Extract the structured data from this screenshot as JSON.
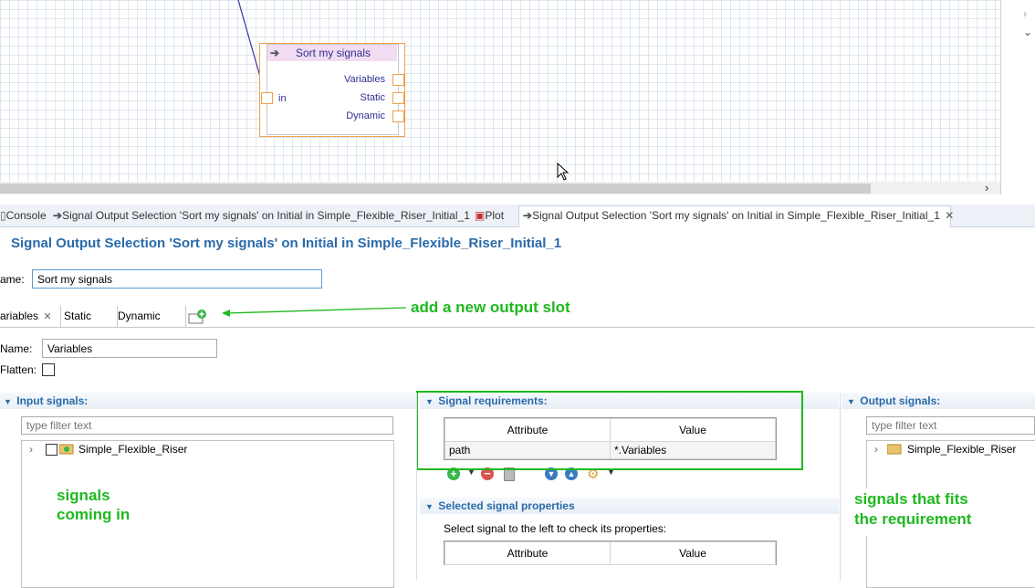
{
  "canvas": {
    "node": {
      "title": "Sort my signals",
      "input_port": "in",
      "output_ports": [
        "Variables",
        "Static",
        "Dynamic"
      ]
    }
  },
  "tabs": [
    {
      "label": "Console",
      "icon": "console-icon"
    },
    {
      "label": "Signal Output Selection 'Sort my signals' on Initial in Simple_Flexible_Riser_Initial_1",
      "icon": "arrow-icon"
    },
    {
      "label": "Plot",
      "icon": "plot-icon"
    },
    {
      "label": "Signal Output Selection 'Sort my signals' on Initial in Simple_Flexible_Riser_Initial_1",
      "icon": "arrow-icon",
      "active": true
    }
  ],
  "editor": {
    "title": "Signal Output Selection 'Sort my signals' on Initial in Simple_Flexible_Riser_Initial_1",
    "name_label": "ame:",
    "name_value": "Sort my signals"
  },
  "slot_tabs": [
    "ariables",
    "Static",
    "Dynamic"
  ],
  "slot": {
    "name_label": "Name:",
    "name_value": "Variables",
    "flatten_label": "Flatten:"
  },
  "input_signals": {
    "header": "Input signals:",
    "filter_placeholder": "type filter text",
    "tree_item": "Simple_Flexible_Riser"
  },
  "signal_requirements": {
    "header": "Signal requirements:",
    "columns": [
      "Attribute",
      "Value"
    ],
    "rows": [
      {
        "attribute": "path",
        "value": "*.Variables"
      }
    ]
  },
  "selected_signal_properties": {
    "header": "Selected signal properties",
    "hint": "Select signal to the left to check its properties:",
    "columns": [
      "Attribute",
      "Value"
    ]
  },
  "output_signals": {
    "header": "Output signals:",
    "filter_placeholder": "type filter text",
    "tree_item": "Simple_Flexible_Riser"
  },
  "annotations": {
    "new_slot": "add a new output slot",
    "signals_in_1": "signals",
    "signals_in_2": "coming in",
    "fits_1": "signals that fits",
    "fits_2": "the requirement"
  },
  "colors": {
    "accent": "#2a6aa9",
    "annotation": "#1fb81f",
    "port_border": "#f0a04a",
    "node_header": "#f2dcf2"
  }
}
